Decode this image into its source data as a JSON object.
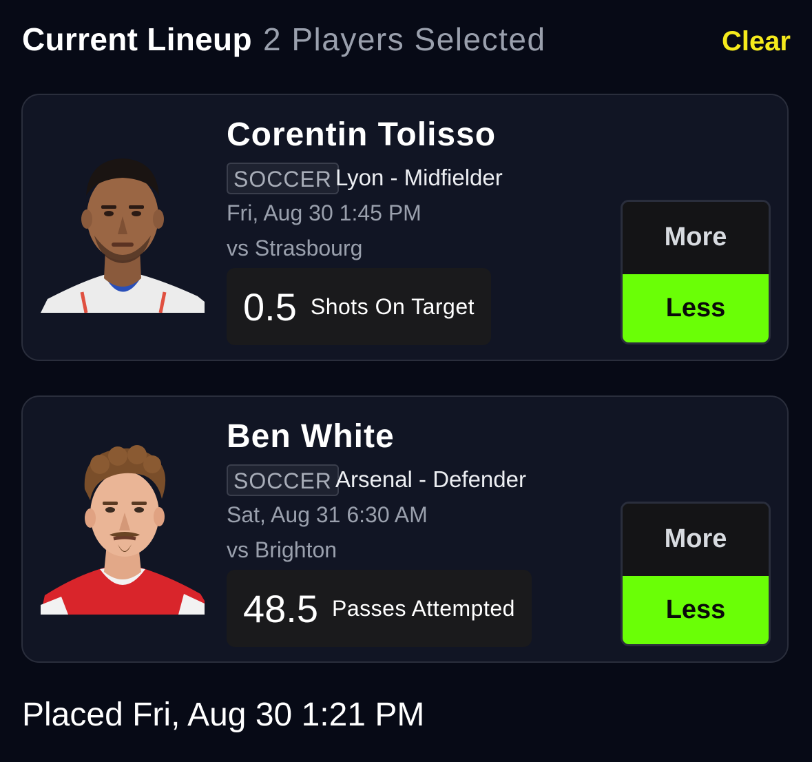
{
  "header": {
    "title": "Current Lineup",
    "count_label": "2 Players Selected",
    "clear_label": "Clear"
  },
  "colors": {
    "background": "#070a16",
    "card": "#111524",
    "accent_yellow": "#f5ea1c",
    "selected_green": "#6aff06"
  },
  "players": [
    {
      "name": "Corentin Tolisso",
      "sport": "SOCCER",
      "team_position": "Lyon - Midfielder",
      "game_time": "Fri, Aug 30 1:45 PM",
      "opponent": "vs Strasbourg",
      "line_value": "0.5",
      "stat": "Shots On Target",
      "more_label": "More",
      "less_label": "Less",
      "selected": "Less",
      "photo": "player-photo"
    },
    {
      "name": "Ben White",
      "sport": "SOCCER",
      "team_position": "Arsenal - Defender",
      "game_time": "Sat, Aug 31 6:30 AM",
      "opponent": "vs Brighton",
      "line_value": "48.5",
      "stat": "Passes Attempted",
      "more_label": "More",
      "less_label": "Less",
      "selected": "Less",
      "photo": "player-photo"
    }
  ],
  "footer": {
    "placed": "Placed Fri, Aug 30 1:21 PM"
  }
}
